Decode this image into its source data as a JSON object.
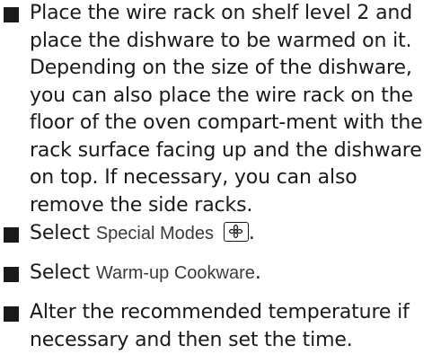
{
  "instructions": [
    {
      "text": "Place the wire rack on shelf level 2 and place the dishware to be warmed on it. Depending on the size of the dishware, you can also place the wire rack on the floor of the oven compart-ment with the rack surface facing up and the dishware on top. If necessary, you can also remove the side racks."
    },
    {
      "prefix": "Select ",
      "term": "Special Modes",
      "icon": "special-modes-icon"
    },
    {
      "prefix": "Select ",
      "term": "Warm-up Cookware",
      "suffix": "."
    },
    {
      "text": "Alter the recommended temperature if necessary and then set the time."
    }
  ],
  "special_modes_suffix": "."
}
